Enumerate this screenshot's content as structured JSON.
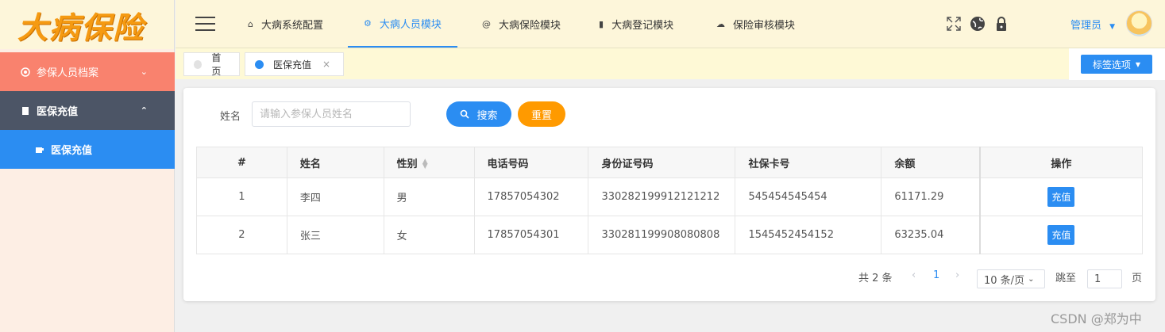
{
  "logo": {
    "text": "大病保险"
  },
  "sidebar": {
    "top_item": {
      "label": "参保人员档案",
      "icon": "gear-icon"
    },
    "group": {
      "label": "医保充值",
      "icon": "file-icon"
    },
    "sub_item": {
      "label": "医保充值",
      "icon": "cup-icon"
    }
  },
  "header": {
    "nav": [
      {
        "label": "大病系统配置",
        "icon": "home-icon"
      },
      {
        "label": "大病人员模块",
        "icon": "settings-icon"
      },
      {
        "label": "大病保险模块",
        "icon": "at-icon"
      },
      {
        "label": "大病登记模块",
        "icon": "book-icon"
      },
      {
        "label": "保险审核模块",
        "icon": "cloud-icon"
      }
    ],
    "admin_label": "管理员"
  },
  "tabs": {
    "items": [
      {
        "label": "首页"
      },
      {
        "label": "医保充值",
        "close": "×"
      }
    ],
    "options_label": "标签选项"
  },
  "search": {
    "name_label": "姓名",
    "placeholder": "请输入参保人员姓名",
    "search_label": "搜索",
    "reset_label": "重置"
  },
  "table": {
    "headers": [
      "#",
      "姓名",
      "性别",
      "电话号码",
      "身份证号码",
      "社保卡号",
      "余额",
      "操作"
    ],
    "rows": [
      {
        "idx": "1",
        "name": "李四",
        "gender": "男",
        "phone": "17857054302",
        "id_card": "330282199912121212",
        "card": "545454545454",
        "balance": "61171.29",
        "action": "充值"
      },
      {
        "idx": "2",
        "name": "张三",
        "gender": "女",
        "phone": "17857054301",
        "id_card": "330281199908080808",
        "card": "1545452454152",
        "balance": "63235.04",
        "action": "充值"
      }
    ]
  },
  "pagination": {
    "total": "共 2 条",
    "current_page": "1",
    "page_size": "10 条/页",
    "goto_label": "跳至",
    "goto_value": "1",
    "page_unit": "页"
  },
  "watermark": "CSDN @郑为中",
  "colors": {
    "accent": "#2b8df2",
    "reset": "#ff9a00",
    "sidebar_top": "#f9826e",
    "sidebar_group": "#4c5566",
    "header_bg": "#fdf6da"
  }
}
